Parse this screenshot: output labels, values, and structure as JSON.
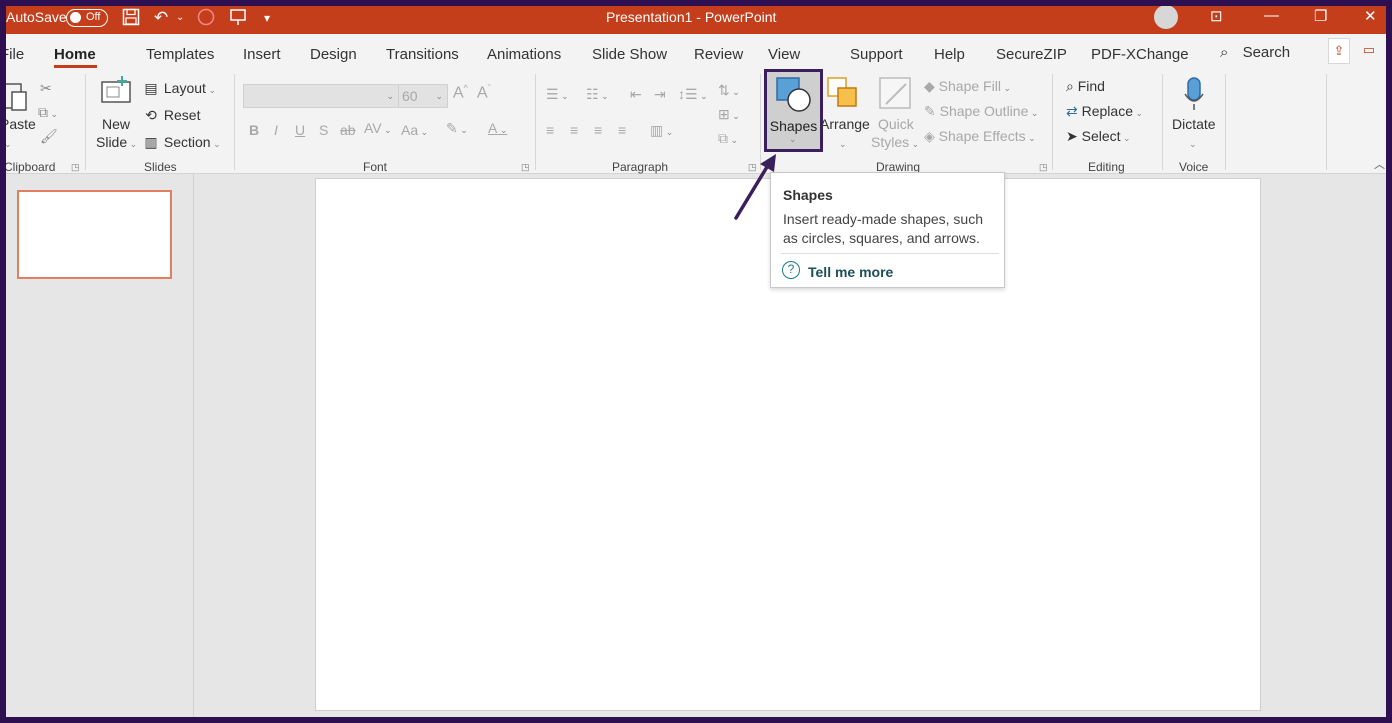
{
  "titlebar": {
    "autosave_label": "AutoSave",
    "toggle_state": "Off",
    "document_title": "Presentation1  -  PowerPoint"
  },
  "tabs": {
    "file": "File",
    "home": "Home",
    "templates": "Templates",
    "insert": "Insert",
    "design": "Design",
    "transitions": "Transitions",
    "animations": "Animations",
    "slideshow": "Slide Show",
    "review": "Review",
    "view": "View",
    "support": "Support",
    "help": "Help",
    "securezip": "SecureZIP",
    "pdfxchange": "PDF-XChange",
    "search": "Search"
  },
  "ribbon": {
    "clipboard": {
      "label": "Clipboard",
      "paste": "Paste"
    },
    "slides": {
      "label": "Slides",
      "new_slide_1": "New",
      "new_slide_2": "Slide",
      "layout": "Layout",
      "reset": "Reset",
      "section": "Section"
    },
    "font": {
      "label": "Font",
      "size": "60"
    },
    "paragraph": {
      "label": "Paragraph"
    },
    "drawing": {
      "label": "Drawing",
      "shapes": "Shapes",
      "arrange": "Arrange",
      "quick_styles_1": "Quick",
      "quick_styles_2": "Styles",
      "shape_fill": "Shape Fill",
      "shape_outline": "Shape Outline",
      "shape_effects": "Shape Effects"
    },
    "editing": {
      "label": "Editing",
      "find": "Find",
      "replace": "Replace",
      "select": "Select"
    },
    "voice": {
      "label": "Voice",
      "dictate": "Dictate"
    }
  },
  "tooltip": {
    "title": "Shapes",
    "body": "Insert ready-made shapes, such as circles, squares, and arrows.",
    "link": "Tell me more"
  },
  "colors": {
    "accent": "#c43e1c",
    "highlight_border": "#3b1f5c"
  }
}
